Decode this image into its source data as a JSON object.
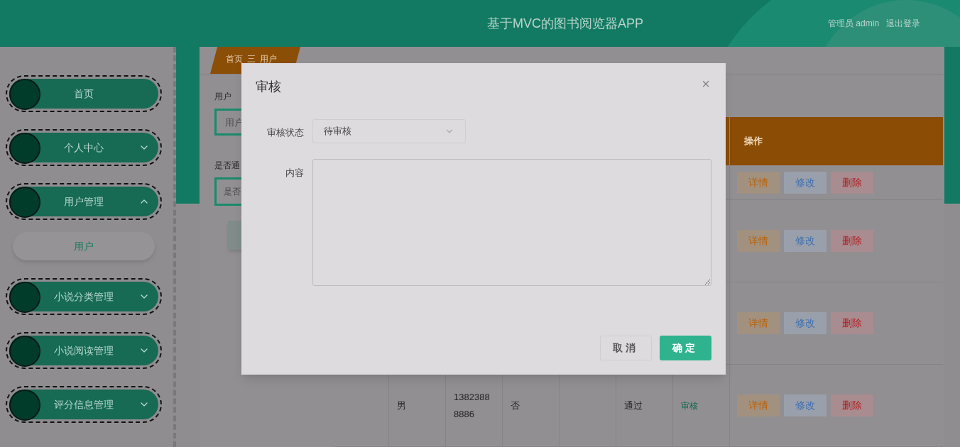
{
  "header": {
    "title": "基于MVC的图书阅览器APP",
    "user": "管理员 admin",
    "logout": "退出登录"
  },
  "sidebar": {
    "items": [
      {
        "label": "首页",
        "kind": "link"
      },
      {
        "label": "个人中心",
        "kind": "menu",
        "expanded": false
      },
      {
        "label": "用户管理",
        "kind": "menu",
        "expanded": true,
        "children": [
          {
            "label": "用户",
            "selected": true
          }
        ]
      },
      {
        "label": "小说分类管理",
        "kind": "menu",
        "expanded": false
      },
      {
        "label": "小说阅读管理",
        "kind": "menu",
        "expanded": false
      },
      {
        "label": "评分信息管理",
        "kind": "menu",
        "expanded": false
      }
    ]
  },
  "breadcrumb": {
    "items": [
      "首页",
      "用户"
    ],
    "separator": "三"
  },
  "filters": [
    {
      "label": "用户",
      "kind": "input",
      "placeholder": "用户"
    },
    {
      "label": "是否通",
      "kind": "select",
      "placeholder": "是否"
    }
  ],
  "table": {
    "action_header": "操作",
    "rows": [
      {
        "actions": [
          {
            "label": "详情",
            "kind": "detail"
          },
          {
            "label": "修改",
            "kind": "edit"
          },
          {
            "label": "删除",
            "kind": "delete"
          }
        ]
      },
      {
        "actions": [
          {
            "label": "详情",
            "kind": "detail"
          },
          {
            "label": "修改",
            "kind": "edit"
          },
          {
            "label": "删除",
            "kind": "delete"
          }
        ]
      },
      {
        "actions": [
          {
            "label": "详情",
            "kind": "detail"
          },
          {
            "label": "修改",
            "kind": "edit"
          },
          {
            "label": "删除",
            "kind": "delete"
          }
        ]
      },
      {
        "gender": "男",
        "phone": "13823888886",
        "member": "否",
        "status": "通过",
        "audit": "审核",
        "actions": [
          {
            "label": "详情",
            "kind": "detail"
          },
          {
            "label": "修改",
            "kind": "edit"
          },
          {
            "label": "删除",
            "kind": "delete"
          }
        ]
      }
    ]
  },
  "modal": {
    "title": "审核",
    "close": "×",
    "fields": [
      {
        "label": "审核状态",
        "kind": "select",
        "value": "待审核"
      },
      {
        "label": "内容",
        "kind": "textarea"
      }
    ],
    "buttons": [
      {
        "label": "取消",
        "kind": "secondary"
      },
      {
        "label": "确定",
        "kind": "primary"
      }
    ]
  }
}
